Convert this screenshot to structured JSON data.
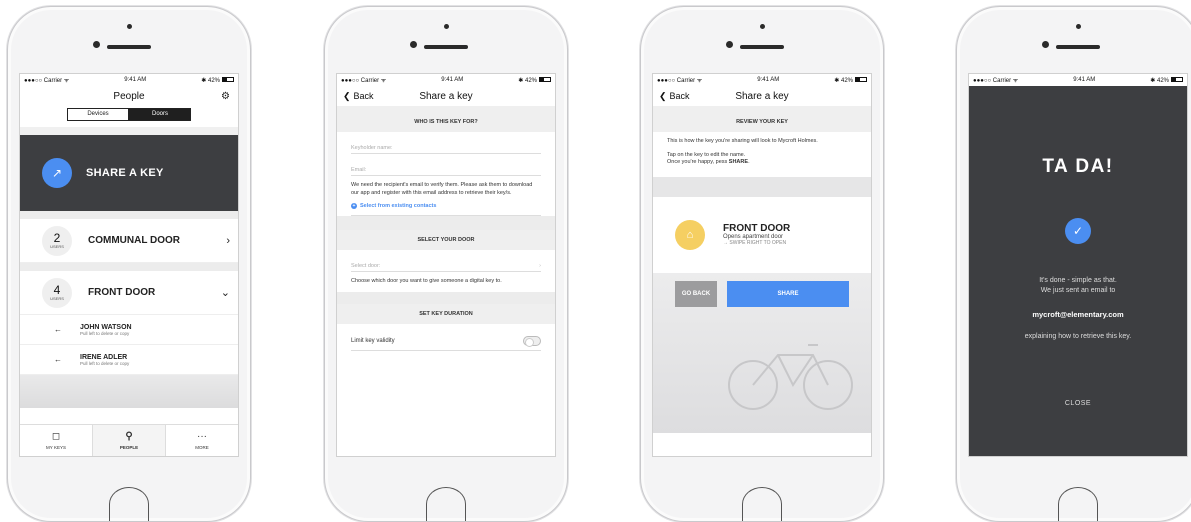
{
  "status": {
    "carrier": "●●●○○ Carrier ᯤ",
    "time": "9:41 AM",
    "battery": "✱ 42%"
  },
  "screen1": {
    "title": "People",
    "segments": [
      "Devices",
      "Doors"
    ],
    "share_label": "SHARE A KEY",
    "doors": [
      {
        "count": "2",
        "unit": "USERS",
        "name": "COMMUNAL DOOR",
        "chevron": "›"
      },
      {
        "count": "4",
        "unit": "USERS",
        "name": "FRONT DOOR",
        "chevron": "⌄"
      }
    ],
    "people": [
      {
        "name": "JOHN WATSON",
        "hint": "Pull left to delete or copy"
      },
      {
        "name": "IRENE ADLER",
        "hint": "Pull left to delete or copy"
      }
    ],
    "tabs": [
      {
        "icon": "◻",
        "label": "MY KEYS"
      },
      {
        "icon": "⚲",
        "label": "PEOPLE"
      },
      {
        "icon": "···",
        "label": "MORE"
      }
    ]
  },
  "screen2": {
    "back": "Back",
    "title": "Share a key",
    "section1": "WHO IS THIS KEY FOR?",
    "keyholder_placeholder": "Keyholder name:",
    "email_placeholder": "Email:",
    "email_note": "We need the recipient's email to verify them. Please ask them to download our app and register with this email address to retrieve their key/s.",
    "contacts_link": "Select from existing contacts",
    "section2": "SELECT YOUR DOOR",
    "door_placeholder": "Select door:",
    "door_note": "Choose which door you want to give someone a digital key to.",
    "section3": "SET KEY DURATION",
    "limit_label": "Limit key validity"
  },
  "screen3": {
    "back": "Back",
    "title": "Share a key",
    "section": "REVIEW YOUR KEY",
    "intro": "This is how the key you're sharing will look to Mycroft Holmes.",
    "tip1": "Tap on the key to edit the name.",
    "tip2_prefix": "Once you're happy, pess ",
    "tip2_bold": "SHARE",
    "tip2_suffix": ".",
    "key_name": "FRONT DOOR",
    "key_sub": "Opens apartment door",
    "key_hint": "→ SWIPE RIGHT TO OPEN",
    "go_back": "GO BACK",
    "share": "SHARE"
  },
  "screen4": {
    "title": "TA DA!",
    "line1": "It's done - simple as that.",
    "line2": "We just sent an email to",
    "email": "mycroft@elementary.com",
    "line3": "explaining how to retrieve this key.",
    "close": "CLOSE"
  },
  "colors": {
    "accent": "#4b8ef1",
    "dark": "#3d3e41",
    "yellow": "#f5cf62",
    "gray_button": "#9c9c9e"
  }
}
